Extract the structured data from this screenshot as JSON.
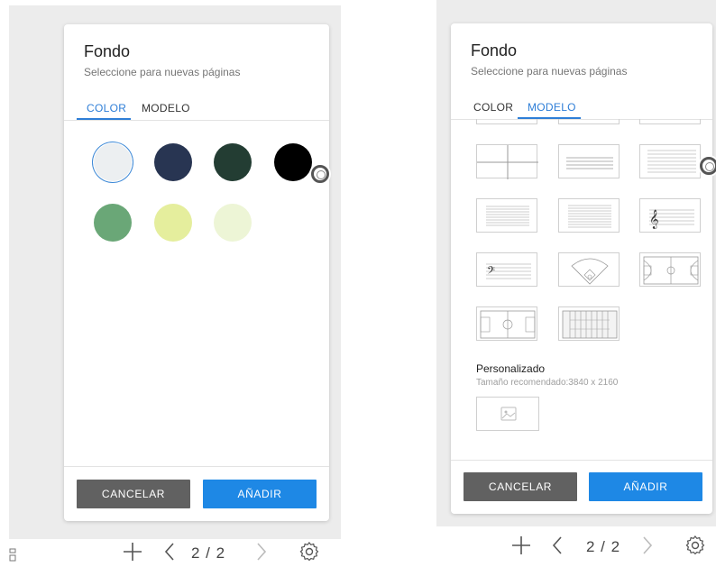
{
  "left_dialog": {
    "title": "Fondo",
    "subtitle": "Seleccione para nuevas páginas",
    "tabs": [
      {
        "label": "COLOR",
        "active": true
      },
      {
        "label": "MODELO",
        "active": false
      }
    ],
    "colors": [
      "#eceff1",
      "#283552",
      "#233d33",
      "#000000",
      "#6aa777",
      "#e5ee9d",
      "#edf5d6"
    ],
    "selected_color_index": 0,
    "buttons": {
      "cancel": "CANCELAR",
      "add": "AÑADIR"
    }
  },
  "right_dialog": {
    "title": "Fondo",
    "subtitle": "Seleccione para nuevas páginas",
    "tabs": [
      {
        "label": "COLOR",
        "active": false
      },
      {
        "label": "MODELO",
        "active": true
      }
    ],
    "templates": [
      "grid-4",
      "lined-1",
      "lined-2",
      "lined-3",
      "lined-4",
      "treble-staff",
      "bass-staff",
      "baseball-field",
      "basketball-court",
      "soccer-field",
      "football-field"
    ],
    "custom_title": "Personalizado",
    "custom_subtitle": "Tamaño recomendado:3840 x 2160",
    "buttons": {
      "cancel": "CANCELAR",
      "add": "AÑADIR"
    }
  },
  "bottom_bar_left": {
    "page": "2 / 2",
    "icons": [
      "qr-icon",
      "plus-icon",
      "chevron-left-icon",
      "chevron-right-icon",
      "gear-icon"
    ]
  },
  "bottom_bar_right": {
    "page": "2 / 2",
    "icons": [
      "plus-icon",
      "chevron-left-icon",
      "chevron-right-icon",
      "gear-icon"
    ]
  }
}
